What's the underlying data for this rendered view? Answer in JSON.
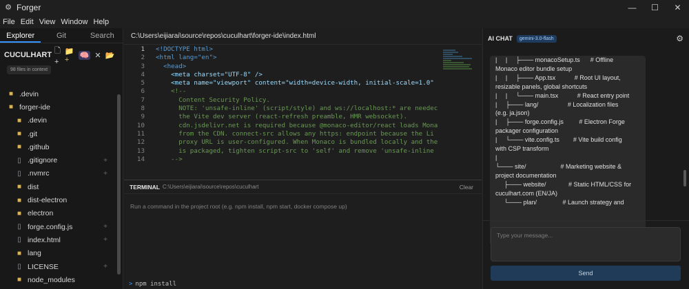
{
  "window": {
    "title": "Forger",
    "app_icon": "gear-icon",
    "minimize": "—",
    "maximize": "☐",
    "close": "✕"
  },
  "menu": [
    "File",
    "Edit",
    "View",
    "Window",
    "Help"
  ],
  "sidebar": {
    "tabs": [
      {
        "label": "Explorer",
        "active": true
      },
      {
        "label": "Git"
      },
      {
        "label": "Search"
      }
    ],
    "project": "CUCULHART",
    "context_badge": "98 files in context",
    "tree": [
      {
        "label": ".devin",
        "type": "folder",
        "level": 0
      },
      {
        "label": "forger-ide",
        "type": "folder",
        "level": 0
      },
      {
        "label": ".devin",
        "type": "folder",
        "level": 1
      },
      {
        "label": ".git",
        "type": "folder",
        "level": 1
      },
      {
        "label": ".github",
        "type": "folder",
        "level": 1
      },
      {
        "label": ".gitignore",
        "type": "file",
        "level": 1
      },
      {
        "label": ".nvmrc",
        "type": "file",
        "level": 1
      },
      {
        "label": "dist",
        "type": "folder",
        "level": 1
      },
      {
        "label": "dist-electron",
        "type": "folder",
        "level": 1
      },
      {
        "label": "electron",
        "type": "folder",
        "level": 1
      },
      {
        "label": "forge.config.js",
        "type": "file",
        "level": 1
      },
      {
        "label": "index.html",
        "type": "file",
        "level": 1
      },
      {
        "label": "lang",
        "type": "folder",
        "level": 1
      },
      {
        "label": "LICENSE",
        "type": "file",
        "level": 1
      },
      {
        "label": "node_modules",
        "type": "folder",
        "level": 1
      }
    ]
  },
  "editor": {
    "path": "C:\\Users\\eijiarai\\source\\repos\\cuculhart\\forger-ide\\index.html",
    "lines": [
      {
        "n": "1",
        "text": "<!DOCTYPE html>"
      },
      {
        "n": "2",
        "text": "<html lang=\"en\">"
      },
      {
        "n": "3",
        "text": "  <head>"
      },
      {
        "n": "4",
        "text": "    <meta charset=\"UTF-8\" />"
      },
      {
        "n": "5",
        "text": "    <meta name=\"viewport\" content=\"width=device-width, initial-scale=1.0\""
      },
      {
        "n": "6",
        "text": "    <!--"
      },
      {
        "n": "7",
        "text": "      Content Security Policy."
      },
      {
        "n": "8",
        "text": "      NOTE: 'unsafe-inline' (script/style) and ws://localhost:* are needec"
      },
      {
        "n": "9",
        "text": "      the Vite dev server (react-refresh preamble, HMR websocket)."
      },
      {
        "n": "10",
        "text": "      cdn.jsdelivr.net is required because @monaco-editor/react loads Mona"
      },
      {
        "n": "11",
        "text": "      from the CDN. connect-src allows any https: endpoint because the Li"
      },
      {
        "n": "12",
        "text": "      proxy URL is user-configured. When Monaco is bundled locally and the"
      },
      {
        "n": "13",
        "text": "      is packaged, tighten script-src to 'self' and remove 'unsafe-inline"
      },
      {
        "n": "14",
        "text": "    -->"
      }
    ]
  },
  "terminal": {
    "title": "TERMINAL",
    "path": "C:\\Users\\eijiarai\\source\\repos\\cuculhart",
    "clear": "Clear",
    "hint": "Run a command in the project root (e.g. npm install, npm start, docker compose up)",
    "prompt_symbol": ">",
    "input": "npm install"
  },
  "chat": {
    "title": "AI CHAT",
    "model": "gemini-3.0-flash",
    "message_lines": [
      "|     |     ├─── monacoSetup.ts      # Offline",
      "Monaco editor bundle setup",
      "|     |     ├─── App.tsx           # Root UI layout,",
      "resizable panels, global shortcuts",
      "|     |     └─── main.tsx           # React entry point",
      "|     ├─── lang/                 # Localization files",
      "(e.g. ja.json)",
      "|     ├─── forge.config.js         # Electron Forge",
      "packager configuration",
      "|     └─── vite.config.ts        # Vite build config",
      "with CSP transform",
      "|",
      "└─── site/                    # Marketing website &",
      "project documentation",
      "     ├─── website/             # Static HTML/CSS for",
      "cuculhart.com (EN/JA)",
      "     └─── plan/               # Launch strategy and"
    ],
    "input_placeholder": "Type your message...",
    "send_label": "Send"
  }
}
